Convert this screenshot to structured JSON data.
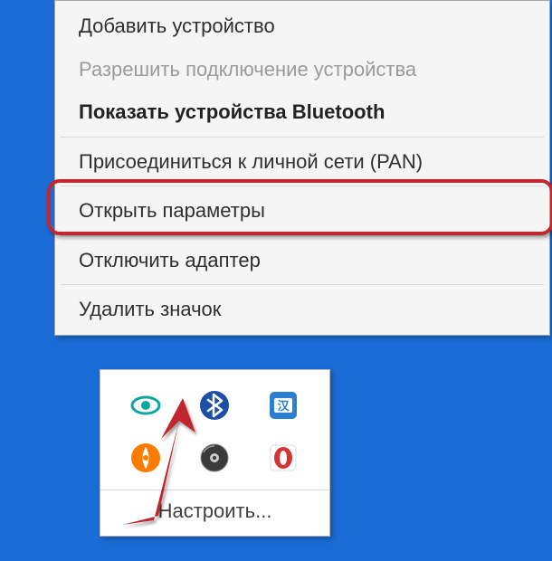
{
  "menu": {
    "add_device": "Добавить устройство",
    "allow_connection": "Разрешить подключение устройства",
    "show_bt_devices": "Показать устройства Bluetooth",
    "join_pan": "Присоединиться к личной сети (PAN)",
    "open_settings": "Открыть параметры",
    "disable_adapter": "Отключить адаптер",
    "remove_icon": "Удалить значок"
  },
  "tray": {
    "customize": "Настроить...",
    "icons": {
      "eye": "eye-icon",
      "bluetooth": "bluetooth-icon",
      "translate": "translate-icon",
      "avast": "avast-icon",
      "disc": "disc-icon",
      "opera": "opera-icon"
    }
  },
  "colors": {
    "desktop": "#1a6dd6",
    "highlight": "#c1272d"
  }
}
